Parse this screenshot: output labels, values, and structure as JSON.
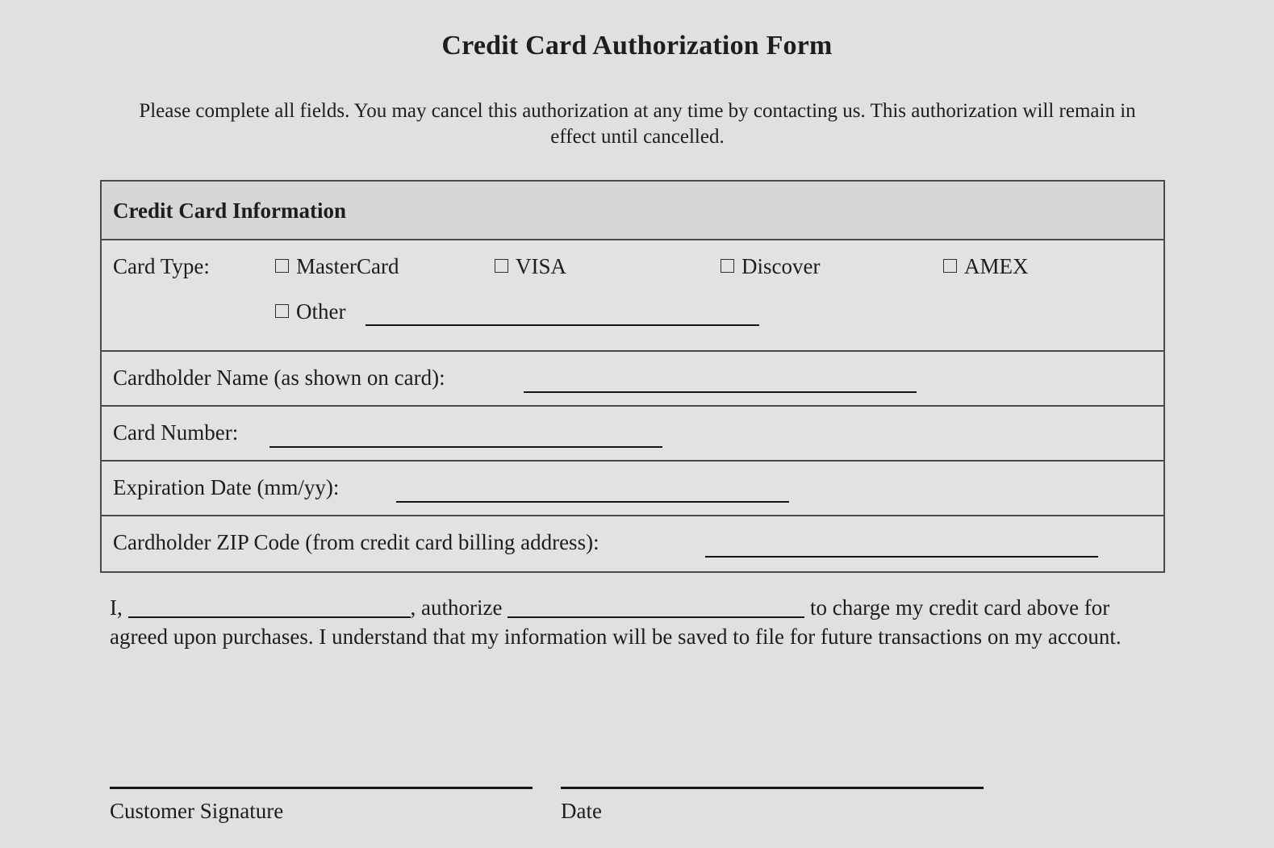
{
  "document": {
    "title": "Credit Card Authorization Form",
    "intro": "Please complete all fields. You may cancel this authorization at any time by contacting us. This authorization will remain in effect until cancelled.",
    "background_color": "#e0e0e0",
    "text_color": "#1d1d1d"
  },
  "table": {
    "header": "Credit Card Information",
    "header_background": "#d6d6d6",
    "body_background": "#e2e2e2",
    "border_color": "#4a4a4a",
    "card_type": {
      "label": "Card Type:",
      "options": [
        {
          "label": "MasterCard",
          "checked": false
        },
        {
          "label": "VISA",
          "checked": false
        },
        {
          "label": "Discover",
          "checked": false
        },
        {
          "label": "AMEX",
          "checked": false
        },
        {
          "label": "Other",
          "checked": false,
          "has_blank": true,
          "value": ""
        }
      ]
    },
    "fields": [
      {
        "label": "Cardholder Name (as shown on card):",
        "value": ""
      },
      {
        "label": "Card Number:",
        "value": ""
      },
      {
        "label": "Expiration Date (mm/yy):",
        "value": ""
      },
      {
        "label": "Cardholder ZIP Code (from credit card billing address):",
        "value": ""
      }
    ]
  },
  "authorization": {
    "lead": "I,",
    "name_value": "",
    "middle": ", authorize",
    "merchant_value": "",
    "tail": "to charge my credit card above for agreed upon purchases. I understand that my information will be saved to file for future transactions on my account."
  },
  "signature": {
    "customer_label": "Customer Signature",
    "date_label": "Date",
    "customer_value": "",
    "date_value": ""
  }
}
